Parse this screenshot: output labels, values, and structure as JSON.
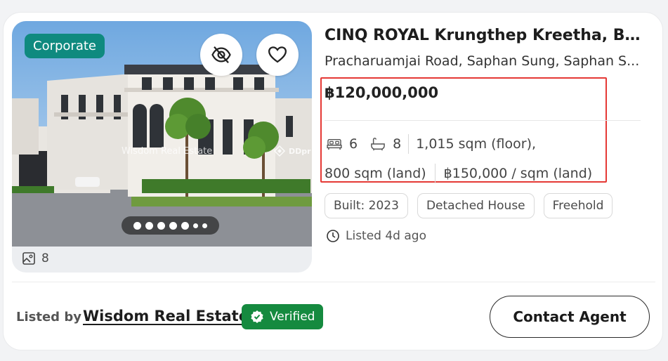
{
  "listing": {
    "corporate_badge": "Corporate",
    "hide_icon": "eye-off-icon",
    "favorite_icon": "heart-icon",
    "watermark_left": "Wisdom Real Estate",
    "watermark_right": "DDpr",
    "photo_dots_total": 7,
    "photo_dots_active": 1,
    "photo_count": "8",
    "title": "CINQ ROYAL Krungthep Kreetha, Ban...",
    "address": "Pracharuamjai Road, Saphan Sung, Saphan S...",
    "price": "฿120,000,000",
    "bedrooms": "6",
    "bathrooms": "8",
    "floor_area": "1,015 sqm (floor),",
    "land_area": "800 sqm (land)",
    "price_per_sqm": "฿150,000 / sqm (land)",
    "chips": [
      "Built: 2023",
      "Detached House",
      "Freehold"
    ],
    "listed_ago": "Listed 4d ago"
  },
  "footer": {
    "listed_by_label": "Listed by",
    "agency_name": "Wisdom Real Estate",
    "verified_label": "Verified",
    "contact_label": "Contact Agent"
  },
  "colors": {
    "corporate_badge": "#0f8a7f",
    "verified_badge": "#158a3f",
    "highlight_border": "#e53935"
  }
}
